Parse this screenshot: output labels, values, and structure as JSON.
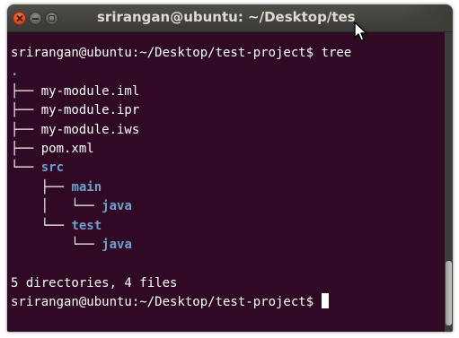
{
  "window": {
    "title": "srirangan@ubuntu: ~/Desktop/tes",
    "buttons": {
      "close": "close-icon",
      "minimize": "minimize-icon",
      "maximize": "maximize-icon"
    }
  },
  "terminal": {
    "prompt_command": "srirangan@ubuntu:~/Desktop/test-project$ tree",
    "tree_root": ".",
    "lines": [
      {
        "branch": "├── ",
        "name": "my-module.iml"
      },
      {
        "branch": "├── ",
        "name": "my-module.ipr"
      },
      {
        "branch": "├── ",
        "name": "my-module.iws"
      },
      {
        "branch": "├── ",
        "name": "pom.xml"
      },
      {
        "branch": "└── ",
        "name": "src"
      },
      {
        "branch": "    ├── ",
        "name": "main"
      },
      {
        "branch": "    │   └── ",
        "name": "java"
      },
      {
        "branch": "    └── ",
        "name": "test"
      },
      {
        "branch": "        └── ",
        "name": "java"
      }
    ],
    "summary": "5 directories, 4 files",
    "final_prompt": "srirangan@ubuntu:~/Desktop/test-project$ "
  },
  "colors": {
    "background": "#300a24",
    "text": "#ffffff",
    "directory": "#729fcf",
    "titlebar": "#3e3d39"
  }
}
